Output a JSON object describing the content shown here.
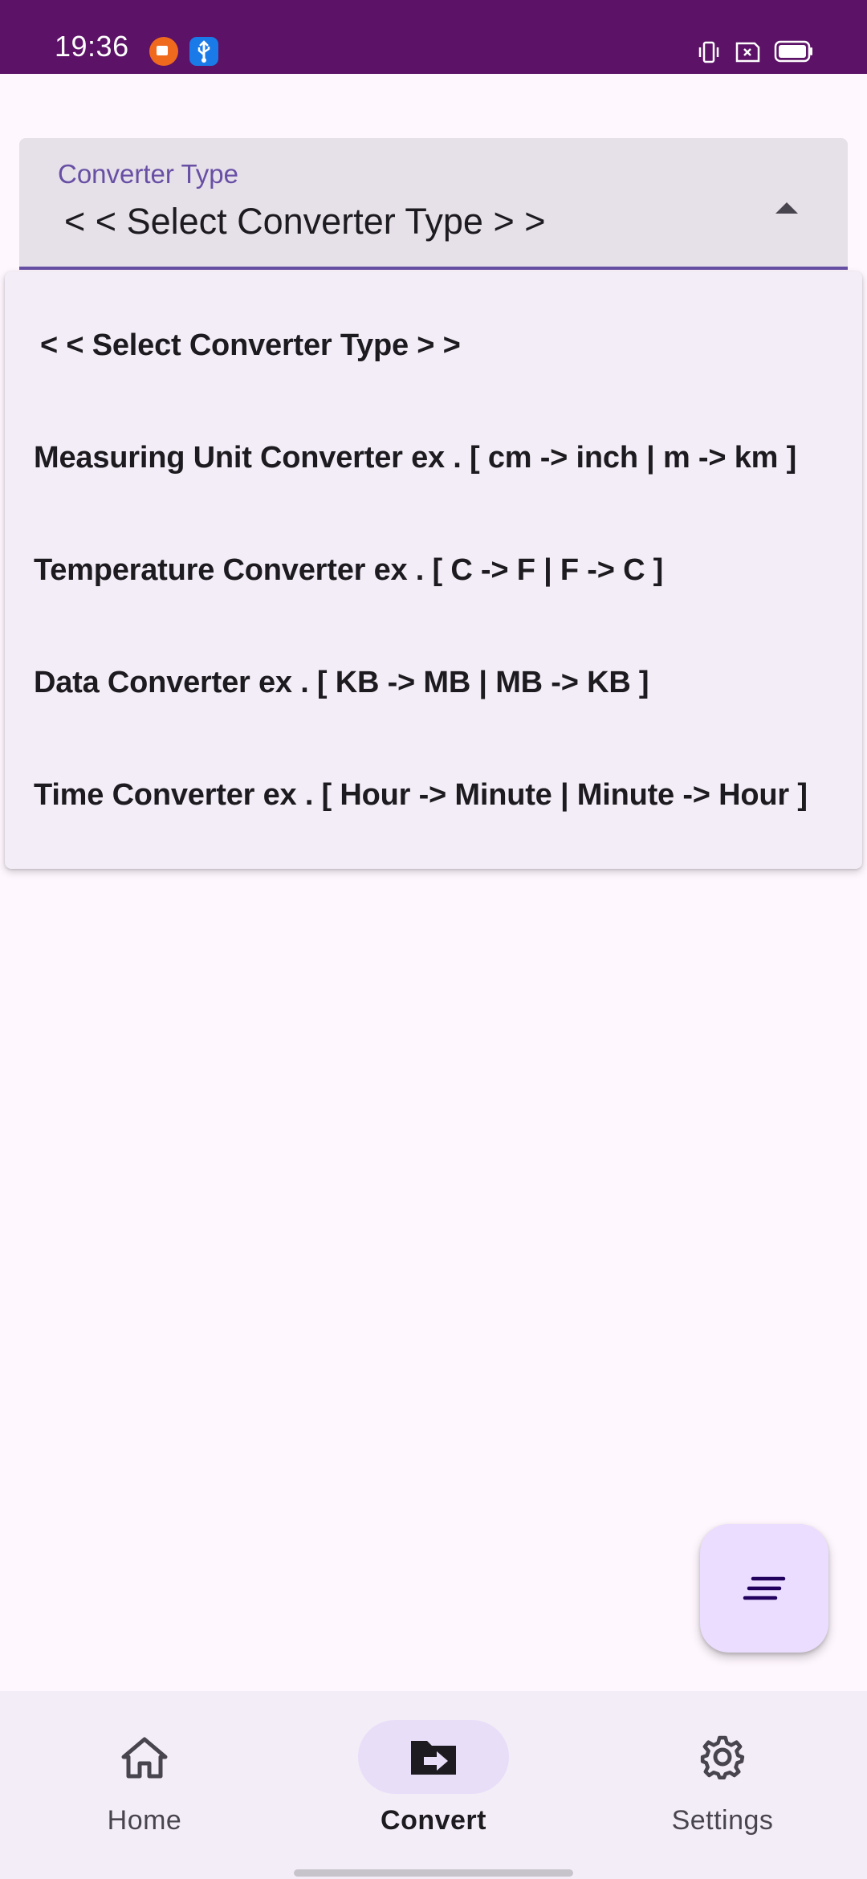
{
  "status_bar": {
    "time": "19:36",
    "notification_icons": [
      "screen-recorder-icon",
      "usb-icon"
    ],
    "system_icons": [
      "vibrate-icon",
      "sim-icon",
      "battery-icon"
    ]
  },
  "dropdown": {
    "label": "Converter Type",
    "selected_value": "< < Select Converter Type > >",
    "expanded": true,
    "arrow_icon": "arrow-drop-up-icon"
  },
  "menu": {
    "items": [
      "< < Select Converter Type > >",
      "Measuring Unit Converter ex . [ cm -> inch | m -> km ]",
      "Temperature Converter ex . [ C -> F | F -> C ]",
      "Data Converter ex . [ KB -> MB | MB -> KB ]",
      "Time Converter ex . [ Hour -> Minute | Minute -> Hour ]"
    ]
  },
  "fab": {
    "icon": "sort-lines-icon"
  },
  "bottom_nav": {
    "items": [
      {
        "label": "Home",
        "icon": "home-icon",
        "active": false
      },
      {
        "label": "Convert",
        "icon": "folder-arrow-icon",
        "active": true
      },
      {
        "label": "Settings",
        "icon": "gear-icon",
        "active": false
      }
    ]
  },
  "colors": {
    "status_bar": "#5C1266",
    "background": "#FFF7FE",
    "primary": "#6750A4",
    "menu_surface": "#F3EDF7",
    "fab": "#EADDFF",
    "nav_active_pill": "#E8DEF8"
  }
}
